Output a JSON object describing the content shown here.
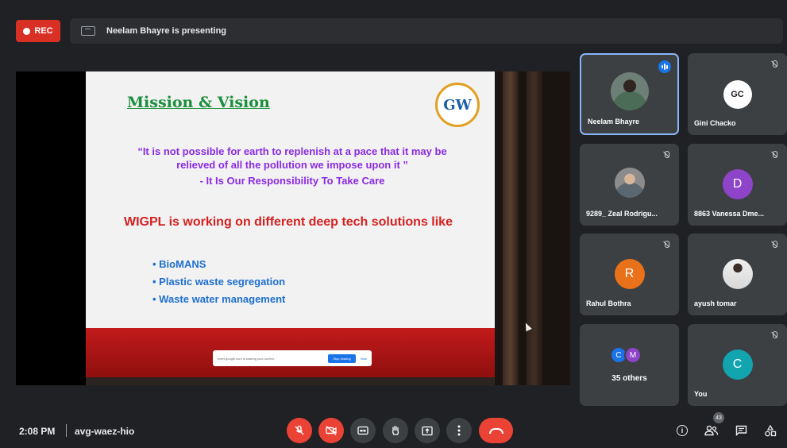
{
  "top_bar": {
    "rec_label": "REC",
    "presenting_text": "Neelam Bhayre is presenting"
  },
  "slide": {
    "title": "Mission & Vision",
    "logo_text": "GW",
    "quote_line1": "“It is not possible for earth to replenish at a pace that it may be relieved of all the pollution we impose upon it ”",
    "quote_line2": "- It Is Our Responsibility To Take Care",
    "headline": "WIGPL is working on different deep tech solutions like",
    "bullets": [
      "BioMANS",
      "Plastic waste segregation",
      "Waste water management"
    ],
    "share_bar": {
      "text": "meet.google.com is sharing your screen.",
      "stop_label": "Stop sharing",
      "hide_label": "Hide"
    }
  },
  "participants": [
    {
      "name": "Neelam Bhayre",
      "type": "photo",
      "speaking": true
    },
    {
      "name": "Gini Chacko",
      "initials": "GC",
      "color": "#ffffff",
      "muted": true
    },
    {
      "name": "9289_ Zeal Rodrigu...",
      "type": "photo",
      "muted": true
    },
    {
      "name": "8863 Vanessa Dme...",
      "initials": "D",
      "color": "#8e44c9",
      "muted": true
    },
    {
      "name": "Rahul Bothra",
      "initials": "R",
      "color": "#e8711a",
      "muted": true
    },
    {
      "name": "ayush tomar",
      "type": "photo",
      "muted": true
    },
    {
      "name": "35 others",
      "mini_initials": [
        "C",
        "M"
      ],
      "mini_colors": [
        "#1a73e8",
        "#8e44c9"
      ]
    },
    {
      "name": "You",
      "initials": "C",
      "color": "#12a4af",
      "muted": true
    }
  ],
  "bottom_bar": {
    "time": "2:08 PM",
    "meeting_code": "avg-waez-hio",
    "people_count": "43"
  },
  "colors": {
    "background": "#202124",
    "tile": "#3c4043",
    "danger": "#ea4335",
    "active_border": "#8ab4f8"
  },
  "icons": [
    "present-icon",
    "mic-off-icon",
    "camera-off-icon",
    "captions-icon",
    "raise-hand-icon",
    "present-now-icon",
    "more-options-icon",
    "end-call-icon",
    "info-icon",
    "people-icon",
    "chat-icon",
    "activities-icon"
  ]
}
